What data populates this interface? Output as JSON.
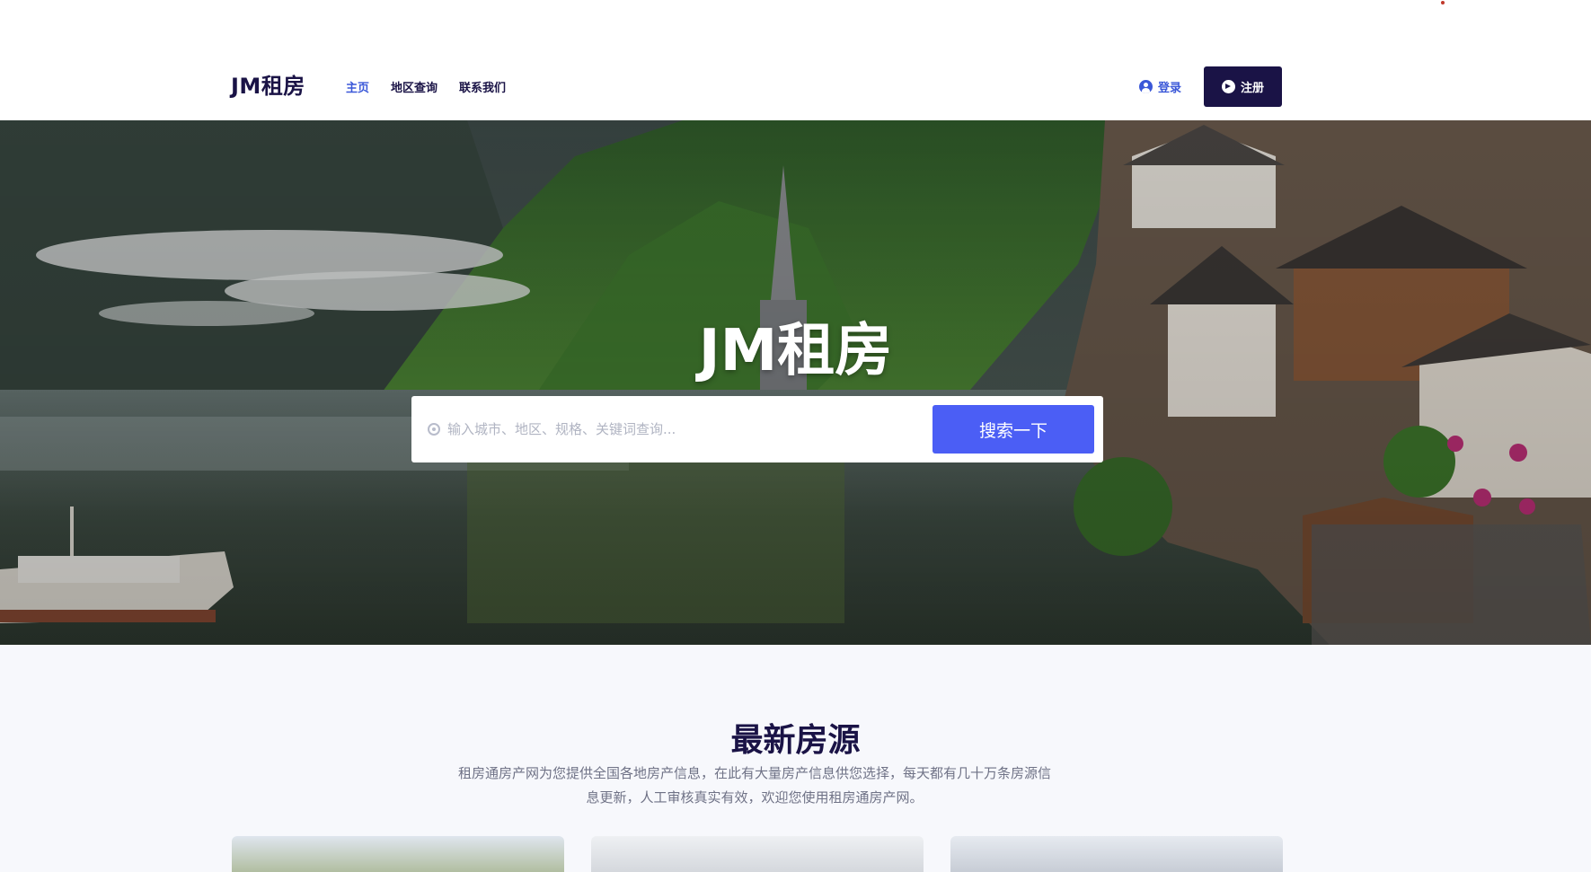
{
  "header": {
    "logo": "JM租房",
    "nav": [
      {
        "label": "主页",
        "active": true
      },
      {
        "label": "地区查询",
        "active": false
      },
      {
        "label": "联系我们",
        "active": false
      }
    ],
    "login_label": "登录",
    "register_label": "注册"
  },
  "hero": {
    "title": "JM租房",
    "search_placeholder": "输入城市、地区、规格、关键词查询...",
    "search_button": "搜索一下",
    "icon": "location-pin-icon"
  },
  "section": {
    "title": "最新房源",
    "description": "租房通房产网为您提供全国各地房产信息，在此有大量房产信息供您选择，每天都有几十万条房源信息更新，人工审核真实有效，欢迎您使用租房通房产网。"
  },
  "colors": {
    "brand_dark": "#1a1346",
    "accent_blue": "#4b5ef5",
    "nav_active": "#3b58d8"
  }
}
